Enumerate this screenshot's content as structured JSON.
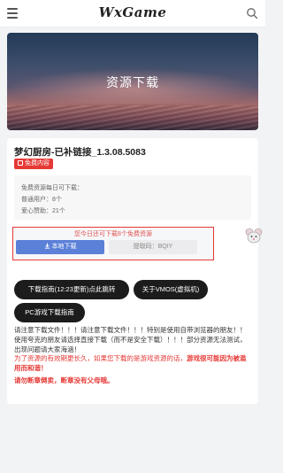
{
  "header": {
    "site_name": "WxGame",
    "menu_icon": "menu-icon",
    "search_icon": "search-icon"
  },
  "banner": {
    "title": "资源下载"
  },
  "post": {
    "title": "梦幻厨房-已补链接_1.3.08.5083",
    "tag": "免费内容",
    "info": [
      "免费资源每日可下载：",
      "普通用户：8个",
      "爱心赞助：21个"
    ]
  },
  "download": {
    "note": "您今日还可下载8个免费资源",
    "button_label": "本地下载",
    "code_label": "提取码：BQIY"
  },
  "actions": {
    "guide_button": "下载指南(12:23更新)点此跳转",
    "vmos_button": "关于VMOS(虚拟机)",
    "pc_button": "PC游戏下载指南"
  },
  "notice": {
    "p1": "请注意下载文件！！！请注意下载文件！！！特别是使用自带浏览器的朋友！！使用夸克的朋友请选择直接下载（而不是安全下载）！！！部分资源无法测试，出现问题请大家海涵！",
    "p2_normal": "为了资源的有效期更长久，如果您下载的是游戏资源的话，",
    "p2_red": "游戏很可能因为被滥用而和谐！",
    "p3": "请勿断章倒卖，断章没有父母哦。"
  },
  "colors": {
    "accent": "#e53935",
    "button": "#5b80d8",
    "pill": "#1c1c1c"
  }
}
